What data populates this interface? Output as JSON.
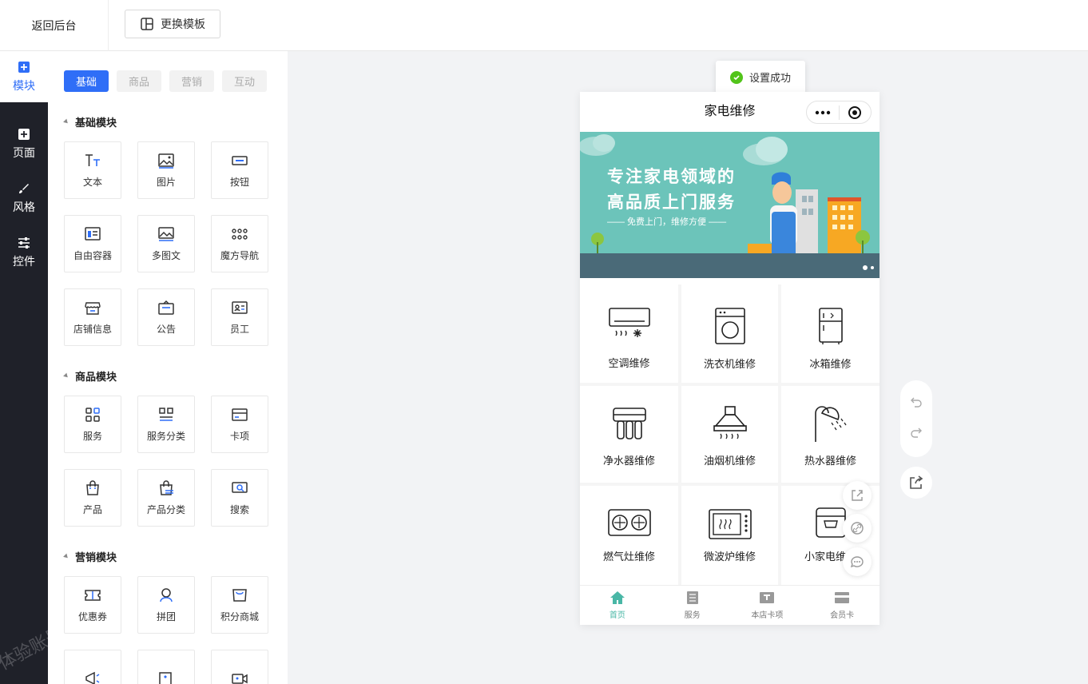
{
  "topbar": {
    "back_label": "返回后台",
    "template_label": "更换模板"
  },
  "nav": {
    "items": [
      {
        "label": "模块",
        "icon": "plus-square-icon"
      },
      {
        "label": "页面",
        "icon": "page-add-icon"
      },
      {
        "label": "风格",
        "icon": "brush-icon"
      },
      {
        "label": "控件",
        "icon": "sliders-icon"
      }
    ],
    "watermark": "体验账号"
  },
  "panel": {
    "tabs": [
      "基础",
      "商品",
      "营销",
      "互动"
    ],
    "sections": [
      {
        "title": "基础模块",
        "items": [
          "文本",
          "图片",
          "按钮",
          "自由容器",
          "多图文",
          "魔方导航",
          "店铺信息",
          "公告",
          "员工"
        ]
      },
      {
        "title": "商品模块",
        "items": [
          "服务",
          "服务分类",
          "卡项",
          "产品",
          "产品分类",
          "搜索"
        ]
      },
      {
        "title": "营销模块",
        "items": [
          "优惠券",
          "拼团",
          "积分商城"
        ]
      }
    ]
  },
  "toast": {
    "text": "设置成功"
  },
  "phone": {
    "title": "家电维修",
    "banner": {
      "line1": "专注家电领域的",
      "line2": "高品质上门服务",
      "sub": "—— 免费上门，维修方便 ——"
    },
    "services": [
      "空调维修",
      "洗衣机维修",
      "冰箱维修",
      "净水器维修",
      "油烟机维修",
      "热水器维修",
      "燃气灶维修",
      "微波炉维修",
      "小家电维修"
    ],
    "tabbar": [
      {
        "label": "首页",
        "icon": "home-icon"
      },
      {
        "label": "服务",
        "icon": "list-icon"
      },
      {
        "label": "本店卡项",
        "icon": "card-icon"
      },
      {
        "label": "会员卡",
        "icon": "member-card-icon"
      }
    ]
  },
  "colors": {
    "accent": "#2f6ef7",
    "nav_bg": "#1f2129",
    "brand_green": "#49b7a6",
    "success": "#52c41a"
  }
}
